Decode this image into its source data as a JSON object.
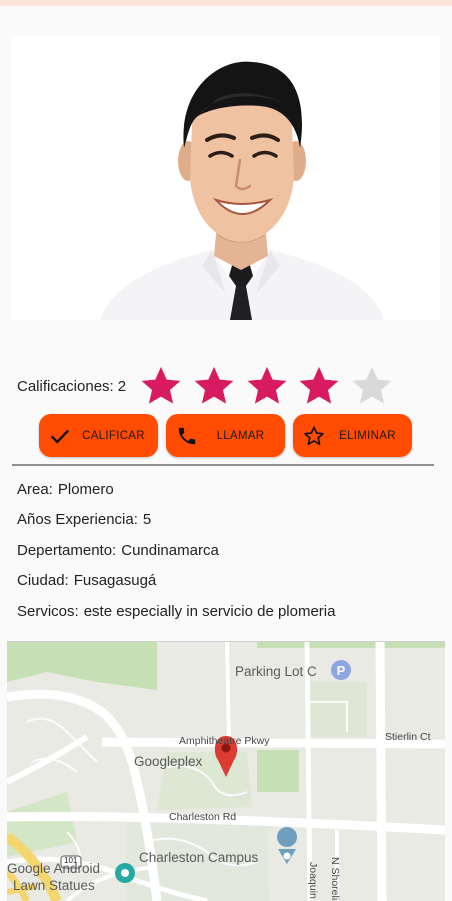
{
  "profile": {
    "photo_alt": "avatar"
  },
  "rating": {
    "label": "Calificaciones:",
    "value": "2",
    "stars_filled": 4,
    "stars_total": 5,
    "star_color": "#d81b60",
    "star_empty_color": "#d9d9d9"
  },
  "buttons": {
    "rate": "CALIFICAR",
    "call": "LLAMAR",
    "delete": "ELIMINAR",
    "color": "#ff4c00"
  },
  "details": {
    "area_label": "Area:",
    "area_value": "Plomero",
    "years_label": "Años Experiencia:",
    "years_value": "5",
    "department_label": "Depertamento:",
    "department_value": "Cundinamarca",
    "city_label": "Ciudad:",
    "city_value": "Fusagasugá",
    "services_label": "Servicos:",
    "services_value": "este especially in servicio de plomeria"
  },
  "map": {
    "labels": {
      "parking": "Parking Lot C",
      "googleplex": "Googleplex",
      "amphitheatre": "Amphitheatre Pkwy",
      "stierlin": "Stierlin Ct",
      "charleston_rd": "Charleston Rd",
      "charleston_campus": "Charleston Campus",
      "android": "Google Android",
      "lawn": "Lawn Statues",
      "shoreline": "N Shoreline Blvd",
      "joaquin": "Joaquin Rd",
      "hwy": "101"
    }
  }
}
